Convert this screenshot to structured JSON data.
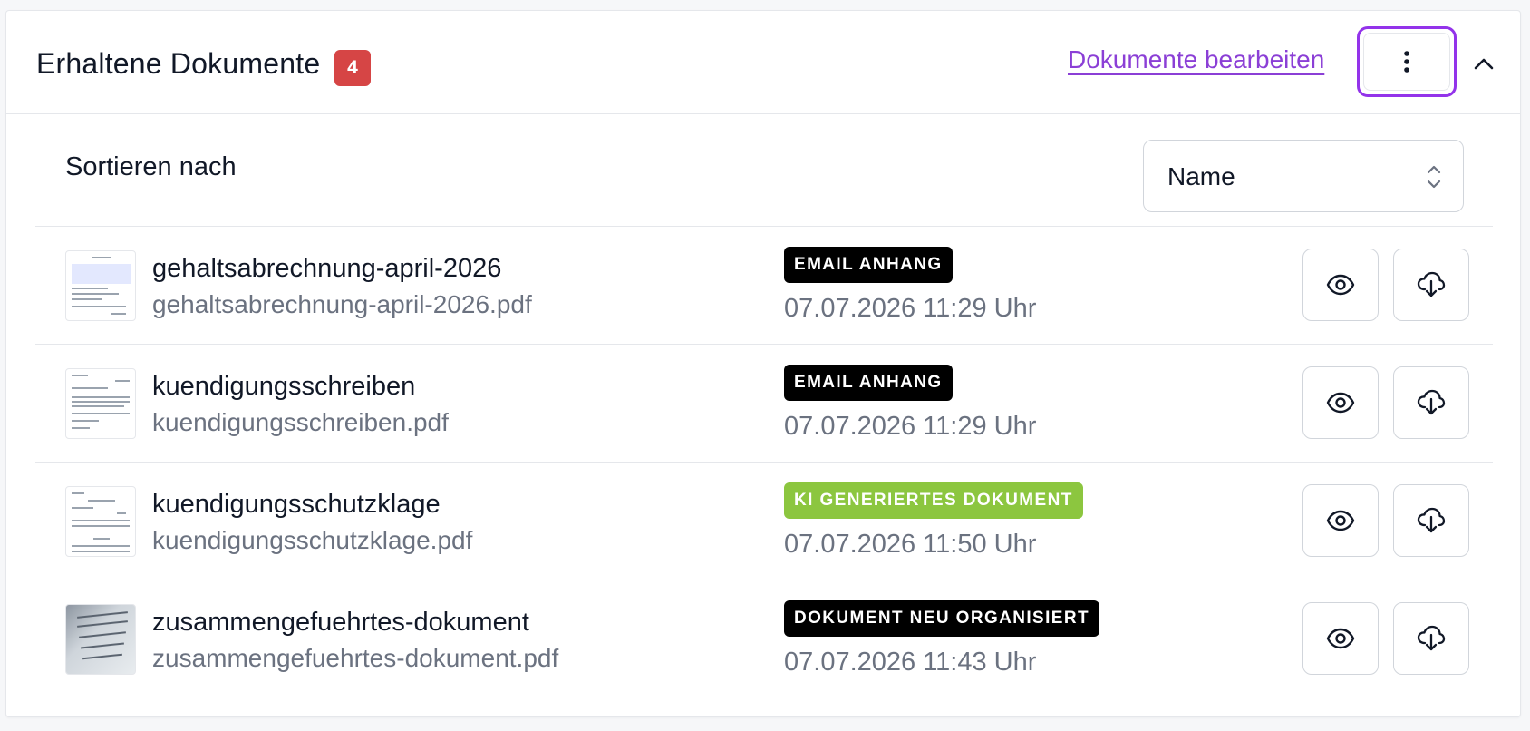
{
  "header": {
    "title": "Erhaltene Dokumente",
    "count": "4",
    "edit_link": "Dokumente bearbeiten",
    "more_icon": "more-vertical-icon",
    "collapse_icon": "chevron-up-icon"
  },
  "sort": {
    "label": "Sortieren nach",
    "selected": "Name",
    "icon": "chevron-updown-icon"
  },
  "colors": {
    "accent": "#8b3fd6",
    "badge_red": "#d64545",
    "tag_black": "#000000",
    "tag_green": "#8cc63f"
  },
  "documents": [
    {
      "name": "gehaltsabrechnung-april-2026",
      "filename": "gehaltsabrechnung-april-2026.pdf",
      "tag": "EMAIL ANHANG",
      "tag_color": "#000000",
      "date": "07.07.2026 11:29 Uhr"
    },
    {
      "name": "kuendigungsschreiben",
      "filename": "kuendigungsschreiben.pdf",
      "tag": "EMAIL ANHANG",
      "tag_color": "#000000",
      "date": "07.07.2026 11:29 Uhr"
    },
    {
      "name": "kuendigungsschutzklage",
      "filename": "kuendigungsschutzklage.pdf",
      "tag": "KI GENERIERTES DOKUMENT",
      "tag_color": "#8cc63f",
      "date": "07.07.2026 11:50 Uhr"
    },
    {
      "name": "zusammengefuehrtes-dokument",
      "filename": "zusammengefuehrtes-dokument.pdf",
      "tag": "DOKUMENT NEU ORGANISIERT",
      "tag_color": "#000000",
      "date": "07.07.2026 11:43 Uhr"
    }
  ]
}
